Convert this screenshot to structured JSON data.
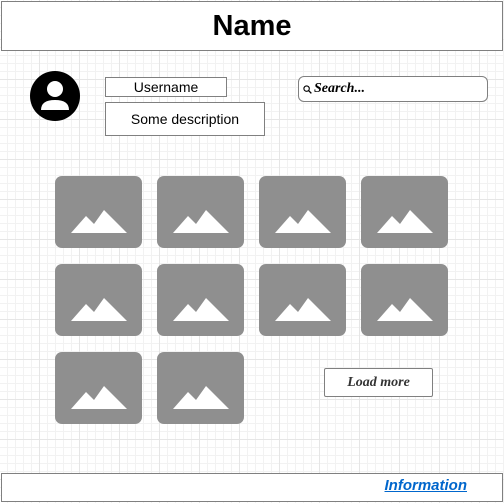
{
  "header": {
    "title": "Name"
  },
  "profile": {
    "avatar_icon": "user-avatar-icon",
    "username": "Username",
    "description": "Some description"
  },
  "search": {
    "placeholder": "Search...",
    "icon": "magnifier-icon"
  },
  "gallery": {
    "image_icon": "image-placeholder-icon",
    "image_count": 10,
    "load_more_label": "Load more"
  },
  "footer": {
    "link_label": "Information"
  },
  "colors": {
    "thumbnail_fill": "#8f8f8f",
    "link": "#0066cc",
    "border": "#808080"
  }
}
